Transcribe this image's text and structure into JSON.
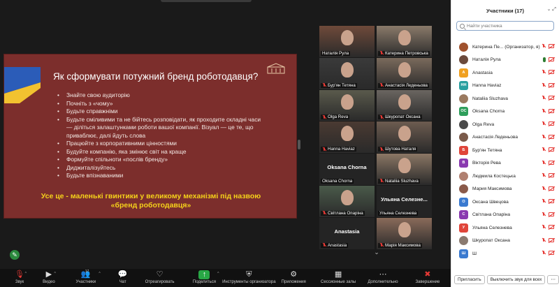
{
  "slide": {
    "title": "Як сформувати потужний бренд роботодавця?",
    "bullets": [
      "Знайте свою аудиторію",
      "Почніть з «чому»",
      "Будьте справжніми",
      "Будьте сміливими та не бійтесь розповідати, як проходите складні часи — діліться залаштунками роботи вашої компанії. Візуал — це те, що приваблює, далі йдуть слова",
      "Працюйте з корпоративними цінностями",
      "Будуйте компанію, яка змінює світ на краще",
      "Формуйте спільноти «послів бренду»",
      "Диджиталізуйтесь",
      "Будьте впізнаваними"
    ],
    "summary_line1": "Усе це - маленькі гвинтики у великому механізмі під назвою",
    "summary_line2": "«бренд роботодавця»",
    "colors": {
      "background": "#7c2e2c",
      "summary": "#f5d21a",
      "flag_blue": "#2b5cb8",
      "flag_yellow": "#f2c230"
    }
  },
  "gallery": [
    {
      "name": "Наталія Рула",
      "muted": false,
      "video": true,
      "tone": "#6f4a3a"
    },
    {
      "name": "Катерина Петровська",
      "muted": true,
      "video": true,
      "tone": "#8a7a6a"
    },
    {
      "name": "Бур'ян Тетяна",
      "muted": true,
      "video": true,
      "tone": "#3a3a3a"
    },
    {
      "name": "Анастасія Леденьова",
      "muted": true,
      "video": true,
      "tone": "#7a6a5c"
    },
    {
      "name": "Olga Reva",
      "muted": true,
      "video": true,
      "tone": "#5a5a4c"
    },
    {
      "name": "Шкуропат Оксана",
      "muted": true,
      "video": true,
      "tone": "#6a6560"
    },
    {
      "name": "Hanna Haviaz",
      "muted": true,
      "video": true,
      "tone": "#4a3a32"
    },
    {
      "name": "Шутова Наталя",
      "muted": true,
      "video": true,
      "tone": "#6d5c50"
    },
    {
      "name": "Oksana Chorna",
      "muted": false,
      "video": false,
      "big": "Oksana Chorna"
    },
    {
      "name": "Nataliia Sluzhava",
      "muted": true,
      "video": true,
      "tone": "#8b7765"
    },
    {
      "name": "Світлана Опаріна",
      "muted": true,
      "video": true,
      "tone": "#4a5a4a"
    },
    {
      "name": "Ульяна Селезнева",
      "muted": false,
      "video": false,
      "big": "Ульяна Селезне..."
    },
    {
      "name": "Anastasia",
      "muted": true,
      "video": false,
      "big": "Anastasia"
    },
    {
      "name": "Марiя Максимова",
      "muted": true,
      "video": true,
      "tone": "#8a6b5a"
    }
  ],
  "toolbar": [
    {
      "label": "Звук",
      "icon": "🎙",
      "danger": true,
      "caret": true,
      "icon_name": "mic-muted-icon"
    },
    {
      "label": "Видео",
      "icon": "▶",
      "caret": true,
      "icon_name": "video-camera-icon"
    },
    {
      "label": "Участники",
      "icon": "👥",
      "badge": "17",
      "caret": true,
      "icon_name": "participants-icon"
    },
    {
      "label": "Чат",
      "icon": "💬",
      "icon_name": "chat-icon"
    },
    {
      "label": "Отреагировать",
      "icon": "♡",
      "icon_name": "react-icon"
    },
    {
      "label": "Поделиться",
      "icon": "↑",
      "green": true,
      "caret": true,
      "icon_name": "share-screen-icon"
    },
    {
      "label": "Инструменты организатора",
      "icon": "⛨",
      "icon_name": "host-tools-icon"
    },
    {
      "label": "Приложения",
      "icon": "⚙",
      "icon_name": "apps-icon"
    },
    {
      "label": "Сессионные залы",
      "icon": "▦",
      "icon_name": "breakout-rooms-icon"
    },
    {
      "label": "Дополнительно",
      "icon": "⋯",
      "icon_name": "more-icon"
    },
    {
      "label": "Завершение",
      "icon": "✖",
      "danger": true,
      "icon_name": "end-meeting-icon"
    }
  ],
  "participants": {
    "title": "Участники (17)",
    "search_placeholder": "Найти участника",
    "invite_label": "Пригласить",
    "mute_all_label": "Выключить звук для всех",
    "people": [
      {
        "name": "Катерина Пе... (Организатор, я)",
        "avatar": "",
        "color": "#a0522d",
        "photo": true
      },
      {
        "name": "Наталія Рула",
        "avatar": "",
        "color": "#6b4a3c",
        "photo": true,
        "talking": true
      },
      {
        "name": "Anastasia",
        "avatar": "A",
        "color": "#f0a020"
      },
      {
        "name": "Hanna Haviaz",
        "avatar": "HH",
        "color": "#2aa0a0"
      },
      {
        "name": "Nataliia Sluzhava",
        "avatar": "",
        "color": "#9a7a60",
        "photo": true
      },
      {
        "name": "Oksana Chorna",
        "avatar": "OC",
        "color": "#2e9e5b"
      },
      {
        "name": "Olga Reva",
        "avatar": "",
        "color": "#4a4a4a",
        "photo": true
      },
      {
        "name": "Анастасія Леденьова",
        "avatar": "",
        "color": "#7a5a4a",
        "photo": true
      },
      {
        "name": "Бур'ян Тетяна",
        "avatar": "Б",
        "color": "#e0453a"
      },
      {
        "name": "Вікторія Рева",
        "avatar": "В",
        "color": "#8a3ab0"
      },
      {
        "name": "Людмила Костецька",
        "avatar": "",
        "color": "#b08070",
        "photo": true
      },
      {
        "name": "Мария Максимова",
        "avatar": "",
        "color": "#8a5a4a",
        "photo": true
      },
      {
        "name": "Оксана Швецова",
        "avatar": "О",
        "color": "#3a7ad0"
      },
      {
        "name": "Світлана Опаріна",
        "avatar": "С",
        "color": "#8a3ab0"
      },
      {
        "name": "Ульяна Селезнева",
        "avatar": "У",
        "color": "#e0453a"
      },
      {
        "name": "Шкуропат Оксана",
        "avatar": "",
        "color": "#8a7a70",
        "photo": true
      },
      {
        "name": "Ш",
        "avatar": "Ш",
        "color": "#3a7ad0"
      }
    ]
  }
}
